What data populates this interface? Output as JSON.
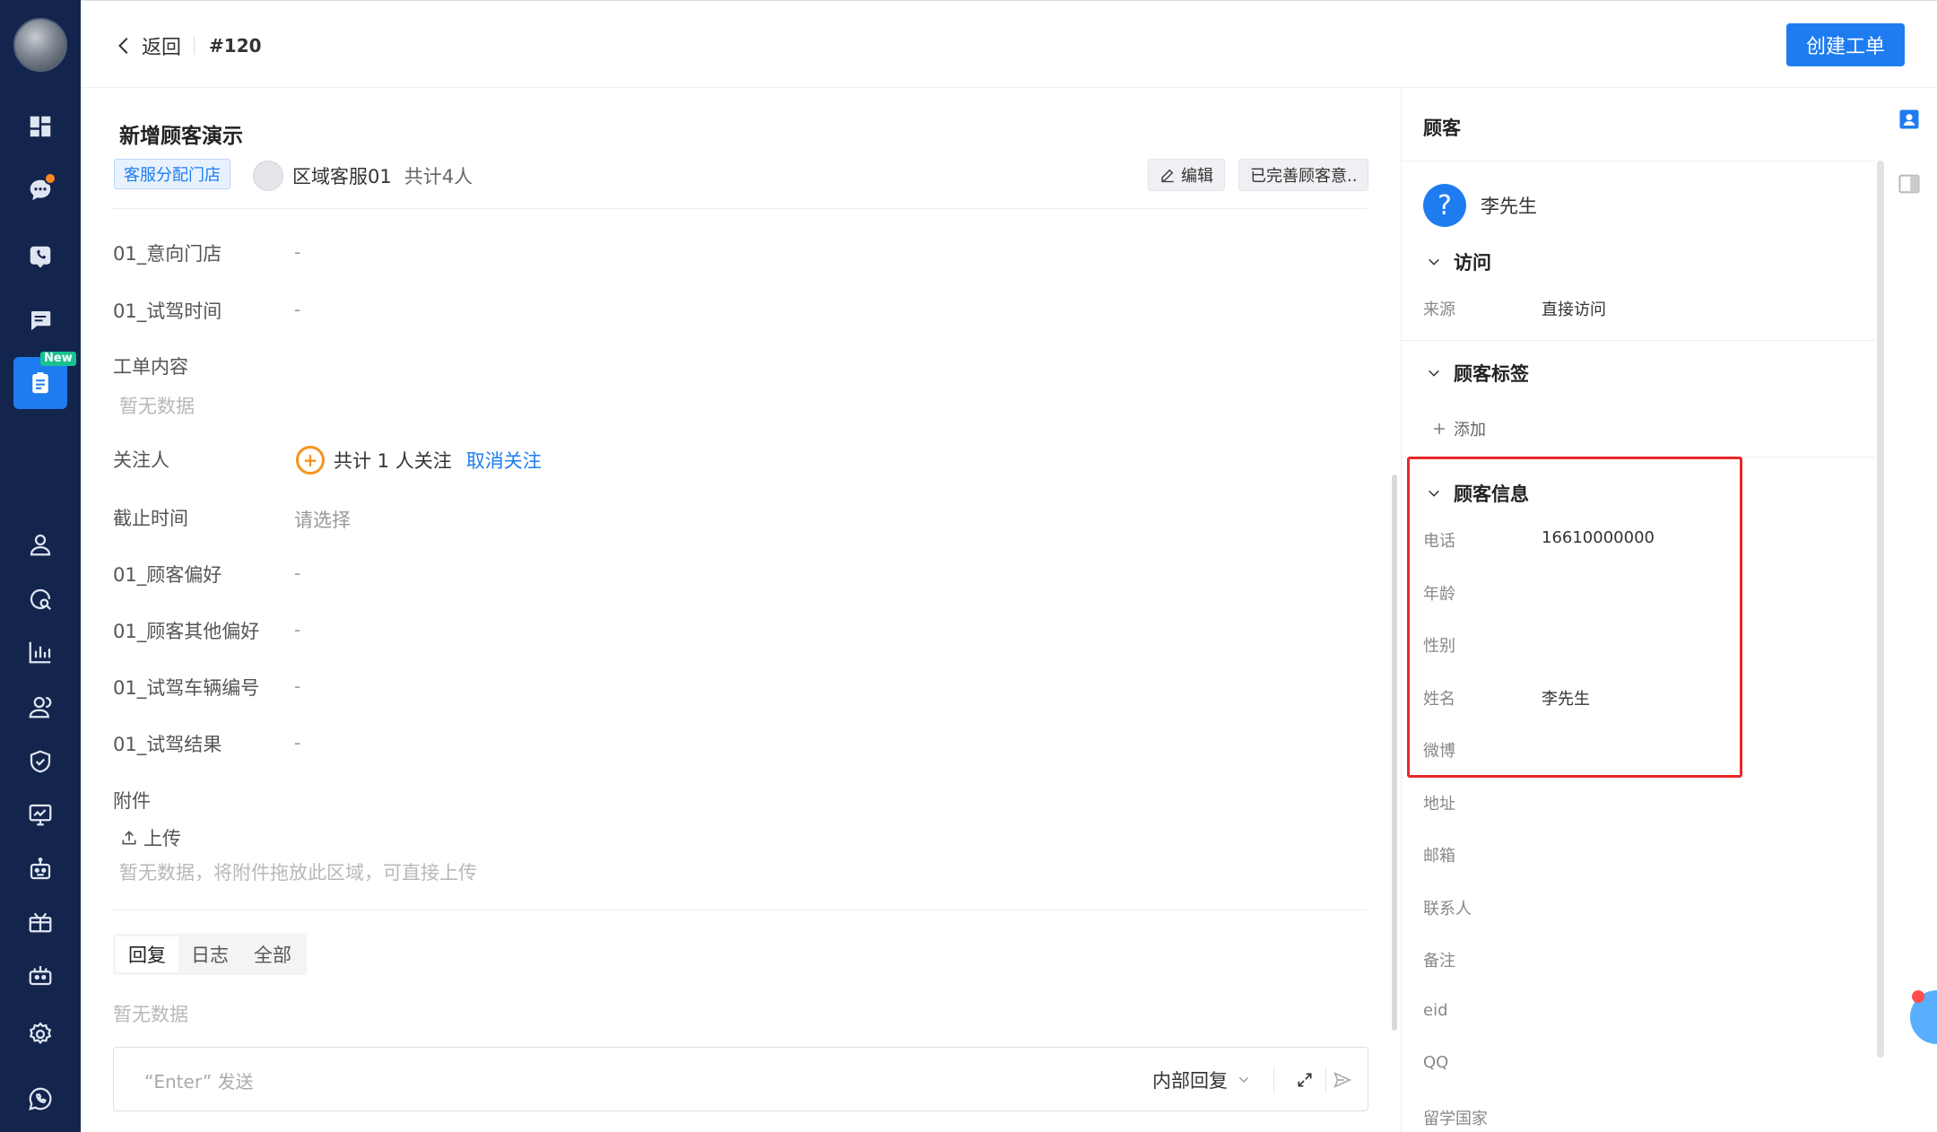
{
  "header": {
    "back_label": "返回",
    "ticket_number": "#120",
    "create_button": "创建工单"
  },
  "ticket": {
    "title": "新增顾客演示",
    "tag": "客服分配门店",
    "assignee": "区域客服01",
    "assignee_count": "共计4人",
    "edit_button": "编辑",
    "status_button": "已完善顾客意.."
  },
  "fields": {
    "store_intent": {
      "label": "01_意向门店",
      "value": "-"
    },
    "test_drive_time": {
      "label": "01_试驾时间",
      "value": "-"
    },
    "content": {
      "label": "工单内容",
      "empty": "暂无数据"
    },
    "followers": {
      "label": "关注人",
      "count_text": "共计 1 人关注",
      "unfollow": "取消关注"
    },
    "deadline": {
      "label": "截止时间",
      "placeholder": "请选择"
    },
    "preference": {
      "label": "01_顾客偏好",
      "value": "-"
    },
    "other_preference": {
      "label": "01_顾客其他偏好",
      "value": "-"
    },
    "vehicle_no": {
      "label": "01_试驾车辆编号",
      "value": "-"
    },
    "drive_result": {
      "label": "01_试驾结果",
      "value": "-"
    },
    "attachment": {
      "label": "附件",
      "upload": "上传",
      "empty": "暂无数据，将附件拖放此区域，可直接上传"
    }
  },
  "reply": {
    "tabs": [
      "回复",
      "日志",
      "全部"
    ],
    "empty": "暂无数据",
    "placeholder": "“Enter” 发送",
    "mode": "内部回复"
  },
  "customer_panel": {
    "title": "顾客",
    "name": "李先生",
    "visit": {
      "title": "访问",
      "source_label": "来源",
      "source_value": "直接访问"
    },
    "tags": {
      "title": "顾客标签",
      "add": "添加"
    },
    "info": {
      "title": "顾客信息",
      "rows": [
        {
          "label": "电话",
          "value": "16610000000"
        },
        {
          "label": "年龄",
          "value": ""
        },
        {
          "label": "性别",
          "value": ""
        },
        {
          "label": "姓名",
          "value": "李先生"
        },
        {
          "label": "微博",
          "value": ""
        },
        {
          "label": "地址",
          "value": ""
        },
        {
          "label": "邮箱",
          "value": ""
        },
        {
          "label": "联系人",
          "value": ""
        },
        {
          "label": "备注",
          "value": ""
        },
        {
          "label": "eid",
          "value": ""
        },
        {
          "label": "QQ",
          "value": ""
        },
        {
          "label": "留学国家",
          "value": ""
        }
      ]
    }
  },
  "nav": {
    "new_badge": "New"
  },
  "colors": {
    "nav_bg": "#14254d",
    "accent": "#1e7cf0",
    "highlight": "#e8282b",
    "follow_orange": "#f7941d"
  }
}
